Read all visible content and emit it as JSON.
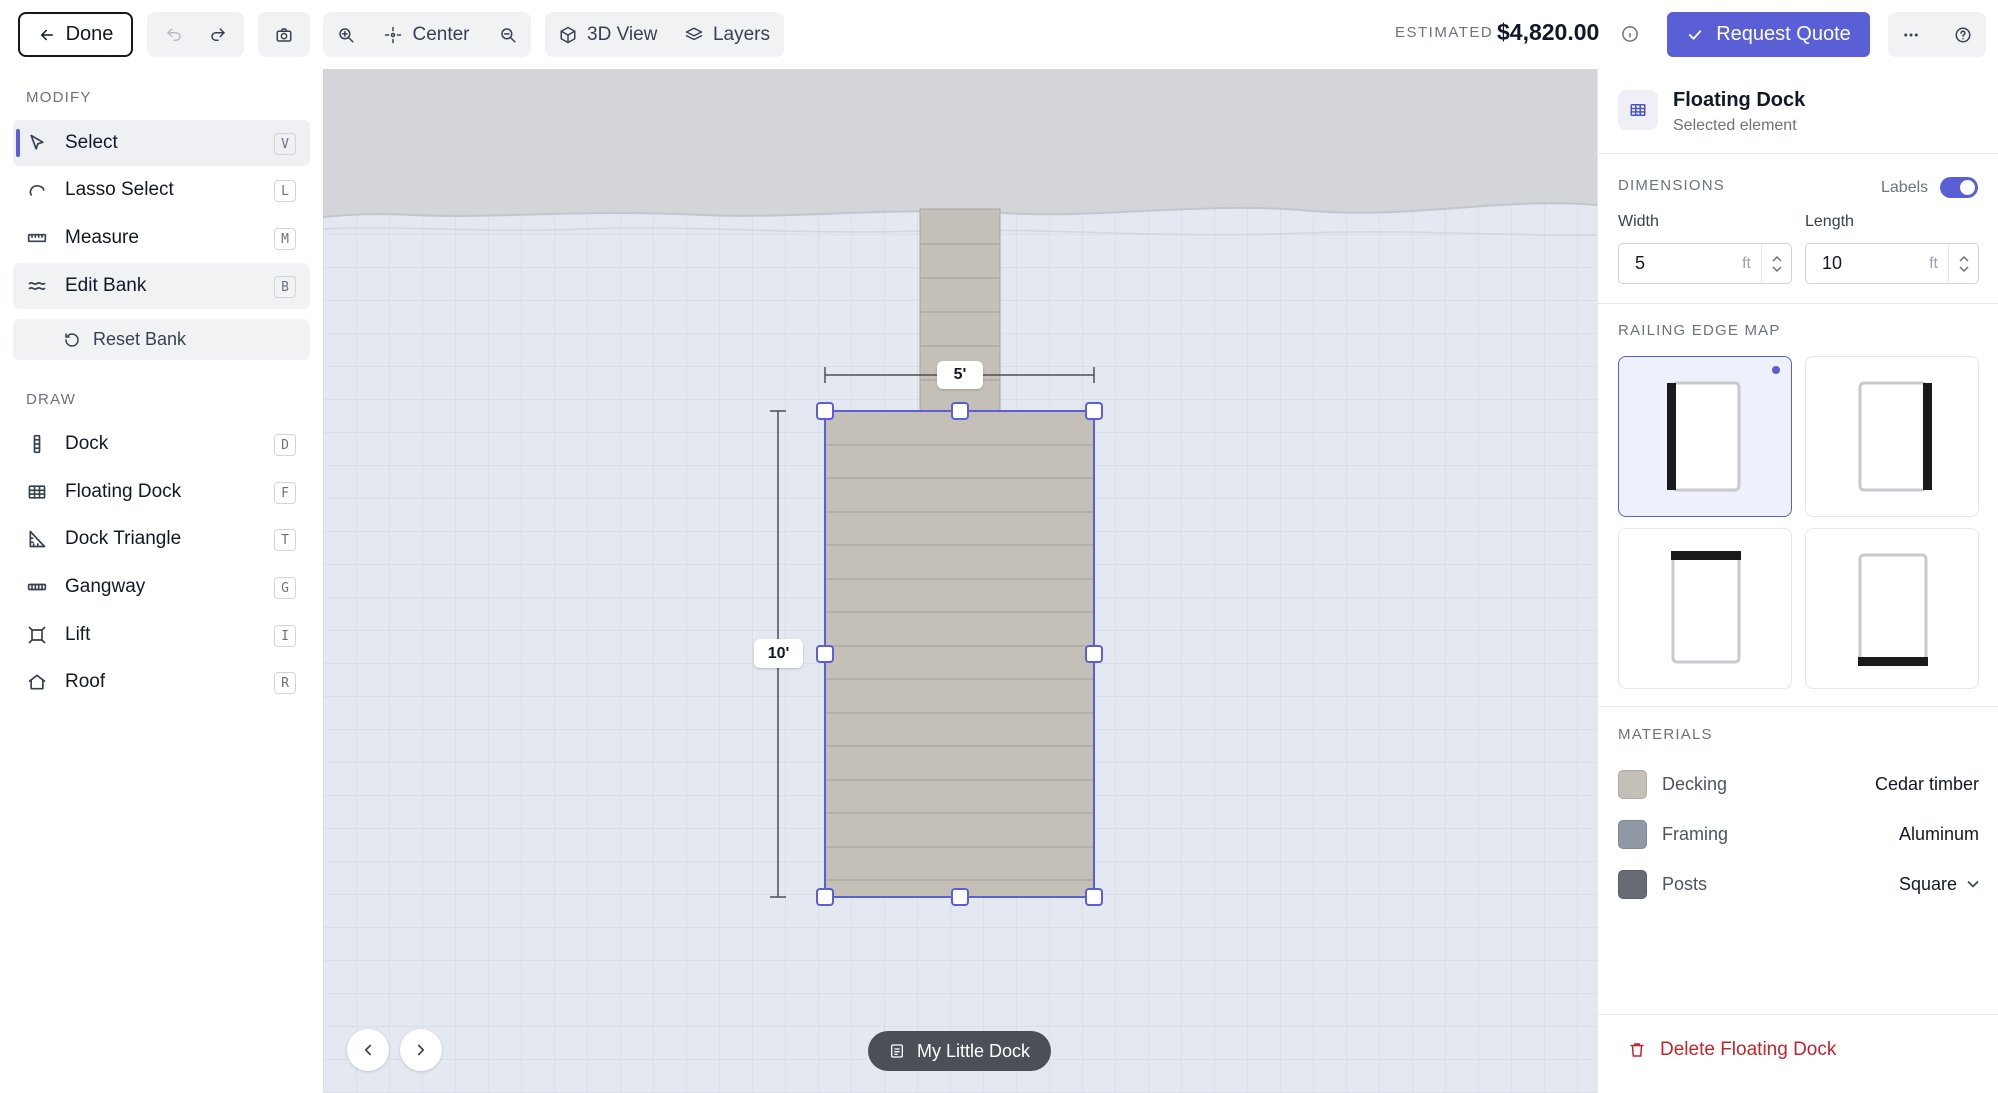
{
  "toolbar": {
    "done_label": "Done",
    "center_label": "Center",
    "view3d_label": "3D View",
    "layers_label": "Layers",
    "estimated_label": "ESTIMATED",
    "price": "$4,820.00",
    "quote_label": "Request Quote"
  },
  "sidebar": {
    "modify_label": "MODIFY",
    "modify_tools": [
      {
        "label": "Select",
        "key": "V",
        "icon": "pointer-icon",
        "state": "active"
      },
      {
        "label": "Lasso Select",
        "key": "L",
        "icon": "lasso-icon"
      },
      {
        "label": "Measure",
        "key": "M",
        "icon": "ruler-icon"
      },
      {
        "label": "Edit Bank",
        "key": "B",
        "icon": "waves-icon",
        "state": "hover"
      }
    ],
    "reset_label": "Reset Bank",
    "draw_label": "DRAW",
    "draw_tools": [
      {
        "label": "Dock",
        "key": "D",
        "icon": "dock-icon"
      },
      {
        "label": "Floating Dock",
        "key": "F",
        "icon": "grid-icon"
      },
      {
        "label": "Dock Triangle",
        "key": "T",
        "icon": "triangle-ruler-icon"
      },
      {
        "label": "Gangway",
        "key": "G",
        "icon": "gangway-icon"
      },
      {
        "label": "Lift",
        "key": "I",
        "icon": "lift-icon"
      },
      {
        "label": "Roof",
        "key": "R",
        "icon": "roof-icon"
      }
    ]
  },
  "canvas": {
    "width_label": "5'",
    "length_label": "10'",
    "project_name": "My Little Dock",
    "colors": {
      "bank": "#d3d5d9",
      "water": "#e4e8f0",
      "decking": "#c4c0b8",
      "selection": "#5a5fd6"
    }
  },
  "panel": {
    "title": "Floating Dock",
    "subtitle": "Selected element",
    "dimensions_label": "DIMENSIONS",
    "labels_toggle": "Labels",
    "width_label": "Width",
    "width_value": "5",
    "length_label": "Length",
    "length_value": "10",
    "unit": "ft",
    "railing_label": "RAILING EDGE MAP",
    "railing_options": [
      "left",
      "right",
      "top",
      "bottom"
    ],
    "railing_selected": "left",
    "materials_label": "MATERIALS",
    "materials": [
      {
        "name": "Decking",
        "value": "Cedar timber",
        "color": "#c4c0b8"
      },
      {
        "name": "Framing",
        "value": "Aluminum",
        "color": "#8f99a6"
      },
      {
        "name": "Posts",
        "value": "Square",
        "color": "#666b75",
        "dropdown": true
      }
    ],
    "delete_label": "Delete Floating Dock"
  }
}
